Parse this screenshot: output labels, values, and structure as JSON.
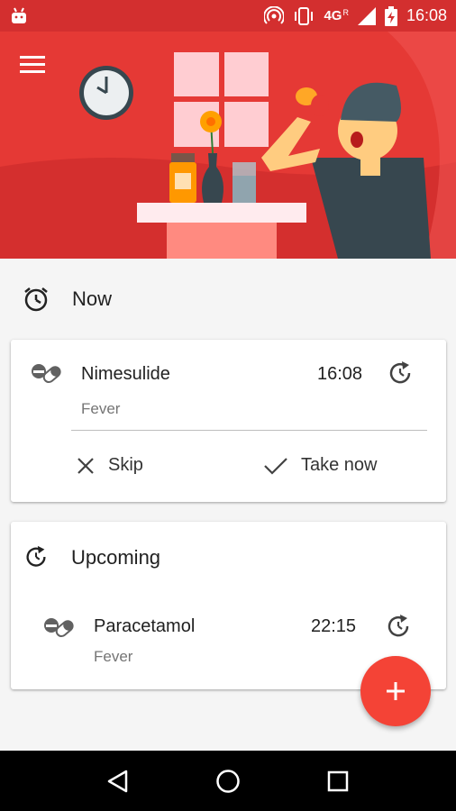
{
  "status_bar": {
    "network": "4G",
    "roaming": "R",
    "time": "16:08"
  },
  "icons": {
    "app": "android-icon",
    "hotspot": "hotspot-icon",
    "vibrate": "vibrate-icon",
    "signal": "signal-icon",
    "battery": "battery-charging-icon",
    "menu": "hamburger-menu-icon",
    "alarm": "alarm-clock-icon",
    "pills": "pills-icon",
    "reschedule": "reschedule-icon",
    "skip": "close-icon",
    "take": "check-icon",
    "add": "plus-icon",
    "back": "back-triangle-icon",
    "home": "home-circle-icon",
    "recents": "recents-square-icon"
  },
  "colors": {
    "accent": "#d32f2f",
    "hero": "#e53935",
    "fab": "#f44336"
  },
  "now": {
    "title": "Now",
    "item": {
      "name": "Nimesulide",
      "reason": "Fever",
      "time": "16:08"
    },
    "skip_label": "Skip",
    "take_label": "Take now"
  },
  "upcoming": {
    "title": "Upcoming",
    "item": {
      "name": "Paracetamol",
      "reason": "Fever",
      "time": "22:15"
    }
  }
}
